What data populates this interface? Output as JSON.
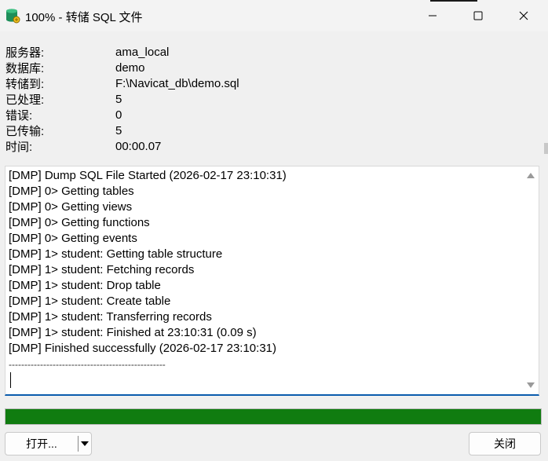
{
  "window": {
    "title": "100% - 转储 SQL 文件",
    "app_icon": "database-icon",
    "controls": [
      "minimize-icon",
      "maximize-icon",
      "close-icon"
    ]
  },
  "info": [
    {
      "label": "服务器:",
      "value": "ama_local"
    },
    {
      "label": "数据库:",
      "value": "demo"
    },
    {
      "label": "转储到:",
      "value": "F:\\Navicat_db\\demo.sql"
    },
    {
      "label": "已处理:",
      "value": "5"
    },
    {
      "label": "错误:",
      "value": "0"
    },
    {
      "label": "已传输:",
      "value": "5"
    },
    {
      "label": "时间:",
      "value": "00:00.07"
    }
  ],
  "log": [
    "[DMP] Dump SQL File Started (2026-02-17 23:10:31)",
    "[DMP] 0> Getting tables",
    "[DMP] 0> Getting views",
    "[DMP] 0> Getting functions",
    "[DMP] 0> Getting events",
    "[DMP] 1> student: Getting table structure",
    "[DMP] 1> student: Fetching records",
    "[DMP] 1> student: Drop table",
    "[DMP] 1> student: Create table",
    "[DMP] 1> student: Transferring records",
    "[DMP] 1> student: Finished at 23:10:31 (0.09 s)",
    "[DMP] Finished successfully (2026-02-17 23:10:31)",
    "--------------------------------------------------"
  ],
  "progress": {
    "percent": 100,
    "color": "#107c10"
  },
  "buttons": {
    "open_label": "打开...",
    "close_label": "关闭"
  },
  "colors": {
    "accent": "#0b5cad",
    "progress": "#107c10"
  }
}
